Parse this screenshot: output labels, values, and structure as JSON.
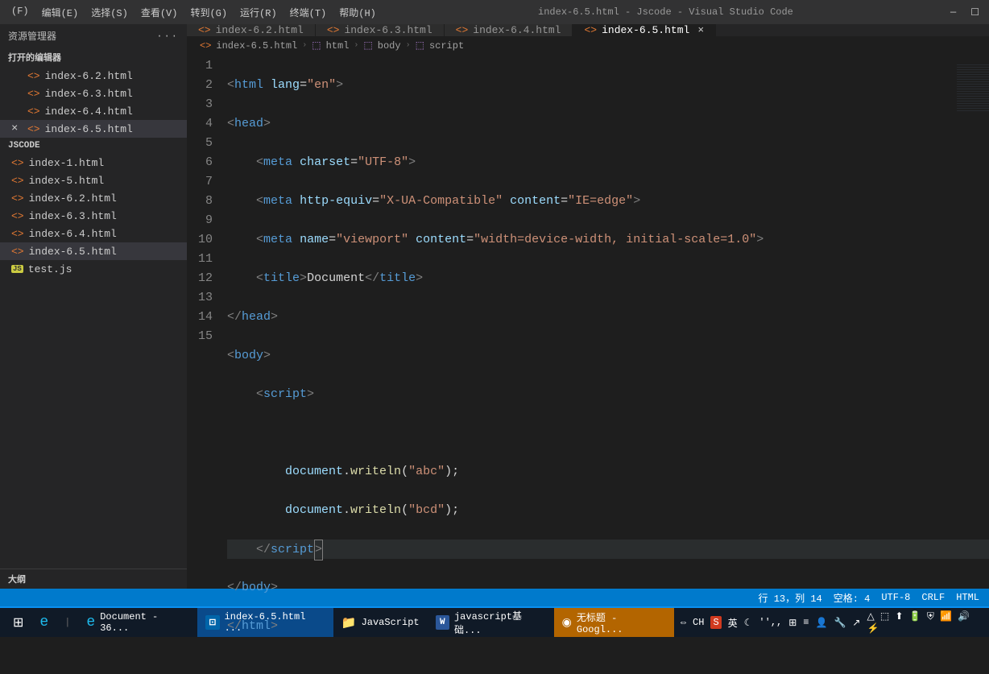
{
  "titlebar": {
    "menus": [
      "(F)",
      "编辑(E)",
      "选择(S)",
      "查看(V)",
      "转到(G)",
      "运行(R)",
      "终端(T)",
      "帮助(H)"
    ],
    "title": "index-6.5.html - Jscode - Visual Studio Code"
  },
  "sidebar": {
    "title": "资源管理器",
    "dots": "···",
    "open_editors_label": "打开的编辑器",
    "open_editors": [
      "index-6.2.html",
      "index-6.3.html",
      "index-6.4.html",
      "index-6.5.html"
    ],
    "workspace_label": "JSCODE",
    "files": [
      "index-1.html",
      "index-5.html",
      "index-6.2.html",
      "index-6.3.html",
      "index-6.4.html",
      "index-6.5.html",
      "test.js"
    ],
    "outline": "大纲"
  },
  "tabs": [
    "index-6.2.html",
    "index-6.3.html",
    "index-6.4.html",
    "index-6.5.html"
  ],
  "breadcrumb": [
    "index-6.5.html",
    "html",
    "body",
    "script"
  ],
  "statusbar": {
    "line_col": "行 13，列 14",
    "spaces": "空格: 4",
    "enc": "UTF-8",
    "eol": "CRLF",
    "lang": "HTML"
  },
  "taskbar": {
    "items": [
      {
        "label": "Document - 36..."
      },
      {
        "label": "index-6.5.html ..."
      },
      {
        "label": "JavaScript"
      },
      {
        "label": "javascript基础..."
      },
      {
        "label": "无标题 - Googl..."
      }
    ],
    "tray": [
      "⇔",
      "CH",
      "S",
      "英",
      "☾",
      "'',,",
      "⊞",
      "≡",
      "👤",
      "🔧",
      "↗"
    ],
    "time": "△ ⬚ ⬆ 🔋 ⛨ 📶 🔊 ⚡"
  },
  "code": {
    "lines": [
      1,
      2,
      3,
      4,
      5,
      6,
      7,
      8,
      9,
      10,
      11,
      12,
      13,
      14,
      15
    ],
    "doc_text": "Document",
    "abc": "\"abc\"",
    "bcd": "\"bcd\""
  }
}
